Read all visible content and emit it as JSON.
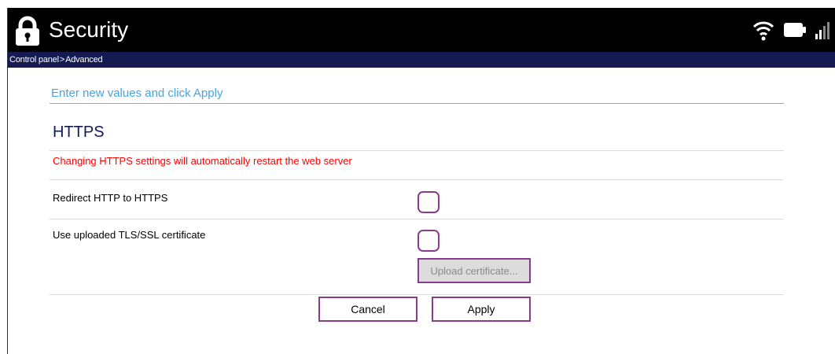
{
  "header": {
    "title": "Security",
    "lock_icon": "lock-icon",
    "status_icons": [
      "wifi-icon",
      "battery-icon",
      "signal-icon"
    ]
  },
  "breadcrumb": {
    "items": [
      "Control panel",
      "Advanced"
    ],
    "separator": ">"
  },
  "form": {
    "instruction": "Enter new values and click Apply",
    "section_title": "HTTPS",
    "warning": "Changing HTTPS settings will automatically restart the web server",
    "options": [
      {
        "label": "Redirect HTTP to HTTPS",
        "checked": false
      },
      {
        "label": "Use uploaded TLS/SSL certificate",
        "checked": false
      }
    ],
    "upload_label": "Upload certificate...",
    "cancel_label": "Cancel",
    "apply_label": "Apply"
  },
  "colors": {
    "titlebar": "#000000",
    "crumbbar": "#141a52",
    "accent_border": "#8b3b8f",
    "instruction": "#4aa3df",
    "warning": "#ff0000"
  }
}
